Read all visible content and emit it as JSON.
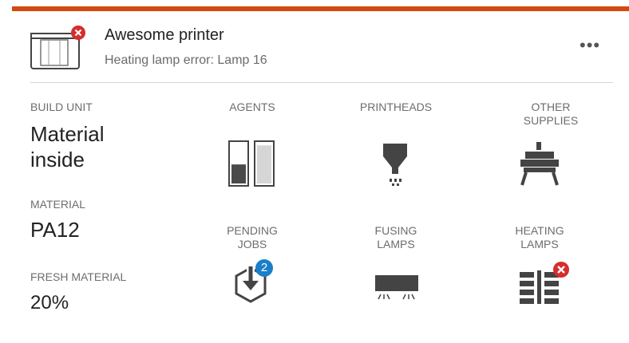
{
  "colors": {
    "accent": "#d14a10",
    "error": "#d62d2d",
    "info": "#1a7fc9"
  },
  "header": {
    "title": "Awesome printer",
    "subtitle": "Heating lamp error: Lamp 16",
    "more_label": "•••",
    "status_icon": "error-icon"
  },
  "details": {
    "build_unit": {
      "label": "BUILD UNIT",
      "value_line1": "Material",
      "value_line2": "inside"
    },
    "material": {
      "label": "MATERIAL",
      "value": "PA12"
    },
    "fresh_material": {
      "label": "FRESH MATERIAL",
      "value": "20%"
    }
  },
  "tiles": {
    "agents": {
      "label": "AGENTS",
      "icon": "agents-icon",
      "levels": [
        0.45,
        0.9
      ]
    },
    "printheads": {
      "label": "PRINTHEADS",
      "icon": "printhead-icon"
    },
    "other_supplies": {
      "label_line1": "OTHER",
      "label_line2": "SUPPLIES",
      "icon": "supplies-icon"
    },
    "pending_jobs": {
      "label_line1": "PENDING",
      "label_line2": "JOBS",
      "icon": "download-icon",
      "badge": "2"
    },
    "fusing_lamps": {
      "label_line1": "FUSING",
      "label_line2": "LAMPS",
      "icon": "fusing-lamp-icon"
    },
    "heating_lamps": {
      "label_line1": "HEATING",
      "label_line2": "LAMPS",
      "icon": "heating-lamp-icon",
      "status": "error"
    }
  }
}
